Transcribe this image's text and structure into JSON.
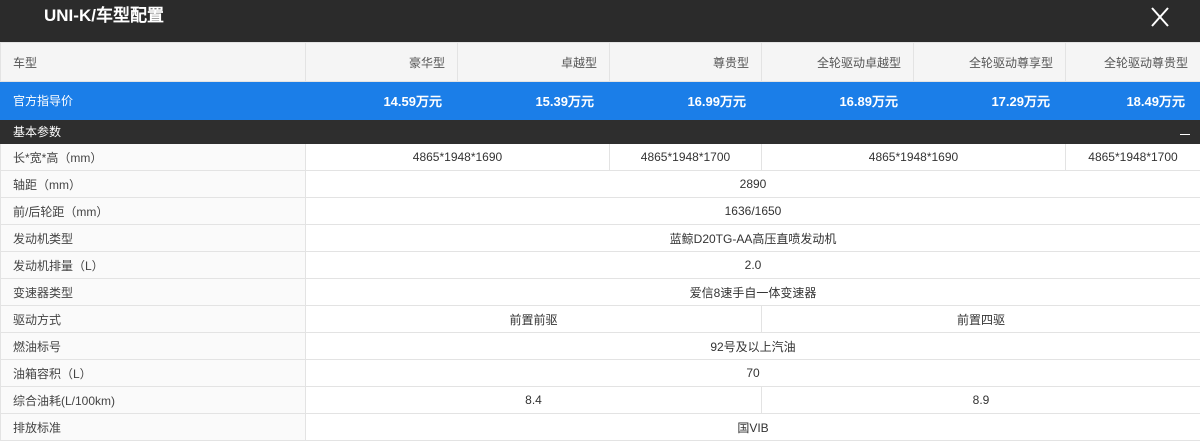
{
  "window": {
    "title": "UNI-K/车型配置",
    "close_icon": "close-icon"
  },
  "colors": {
    "accent": "#1b7ee8",
    "header_bg": "#2b2b2b",
    "section_bg": "#2e2e2e"
  },
  "table": {
    "header_label": "车型",
    "trims": [
      "豪华型",
      "卓越型",
      "尊贵型",
      "全轮驱动卓越型",
      "全轮驱动尊享型",
      "全轮驱动尊贵型"
    ],
    "price_label": "官方指导价",
    "prices": [
      "14.59万元",
      "15.39万元",
      "16.99万元",
      "16.89万元",
      "17.29万元",
      "18.49万元"
    ],
    "section_title": "基本参数",
    "section_toggle": "—",
    "rows": [
      {
        "label": "长*宽*高（mm）",
        "cells": [
          {
            "text": "4865*1948*1690",
            "span": 2
          },
          {
            "text": "4865*1948*1700",
            "span": 1
          },
          {
            "text": "4865*1948*1690",
            "span": 2
          },
          {
            "text": "4865*1948*1700",
            "span": 1
          }
        ]
      },
      {
        "label": "轴距（mm）",
        "cells": [
          {
            "text": "2890",
            "span": 6
          }
        ]
      },
      {
        "label": "前/后轮距（mm）",
        "cells": [
          {
            "text": "1636/1650",
            "span": 6
          }
        ]
      },
      {
        "label": "发动机类型",
        "cells": [
          {
            "text": "蓝鲸D20TG-AA高压直喷发动机",
            "span": 6
          }
        ]
      },
      {
        "label": "发动机排量（L）",
        "cells": [
          {
            "text": "2.0",
            "span": 6
          }
        ]
      },
      {
        "label": "变速器类型",
        "cells": [
          {
            "text": "爱信8速手自一体变速器",
            "span": 6
          }
        ]
      },
      {
        "label": "驱动方式",
        "cells": [
          {
            "text": "前置前驱",
            "span": 3
          },
          {
            "text": "前置四驱",
            "span": 3
          }
        ]
      },
      {
        "label": "燃油标号",
        "cells": [
          {
            "text": "92号及以上汽油",
            "span": 6
          }
        ]
      },
      {
        "label": "油箱容积（L）",
        "cells": [
          {
            "text": "70",
            "span": 6
          }
        ]
      },
      {
        "label": "综合油耗(L/100km)",
        "cells": [
          {
            "text": "8.4",
            "span": 3
          },
          {
            "text": "8.9",
            "span": 3
          }
        ]
      },
      {
        "label": "排放标准",
        "cells": [
          {
            "text": "国VIB",
            "span": 6
          }
        ]
      }
    ]
  }
}
